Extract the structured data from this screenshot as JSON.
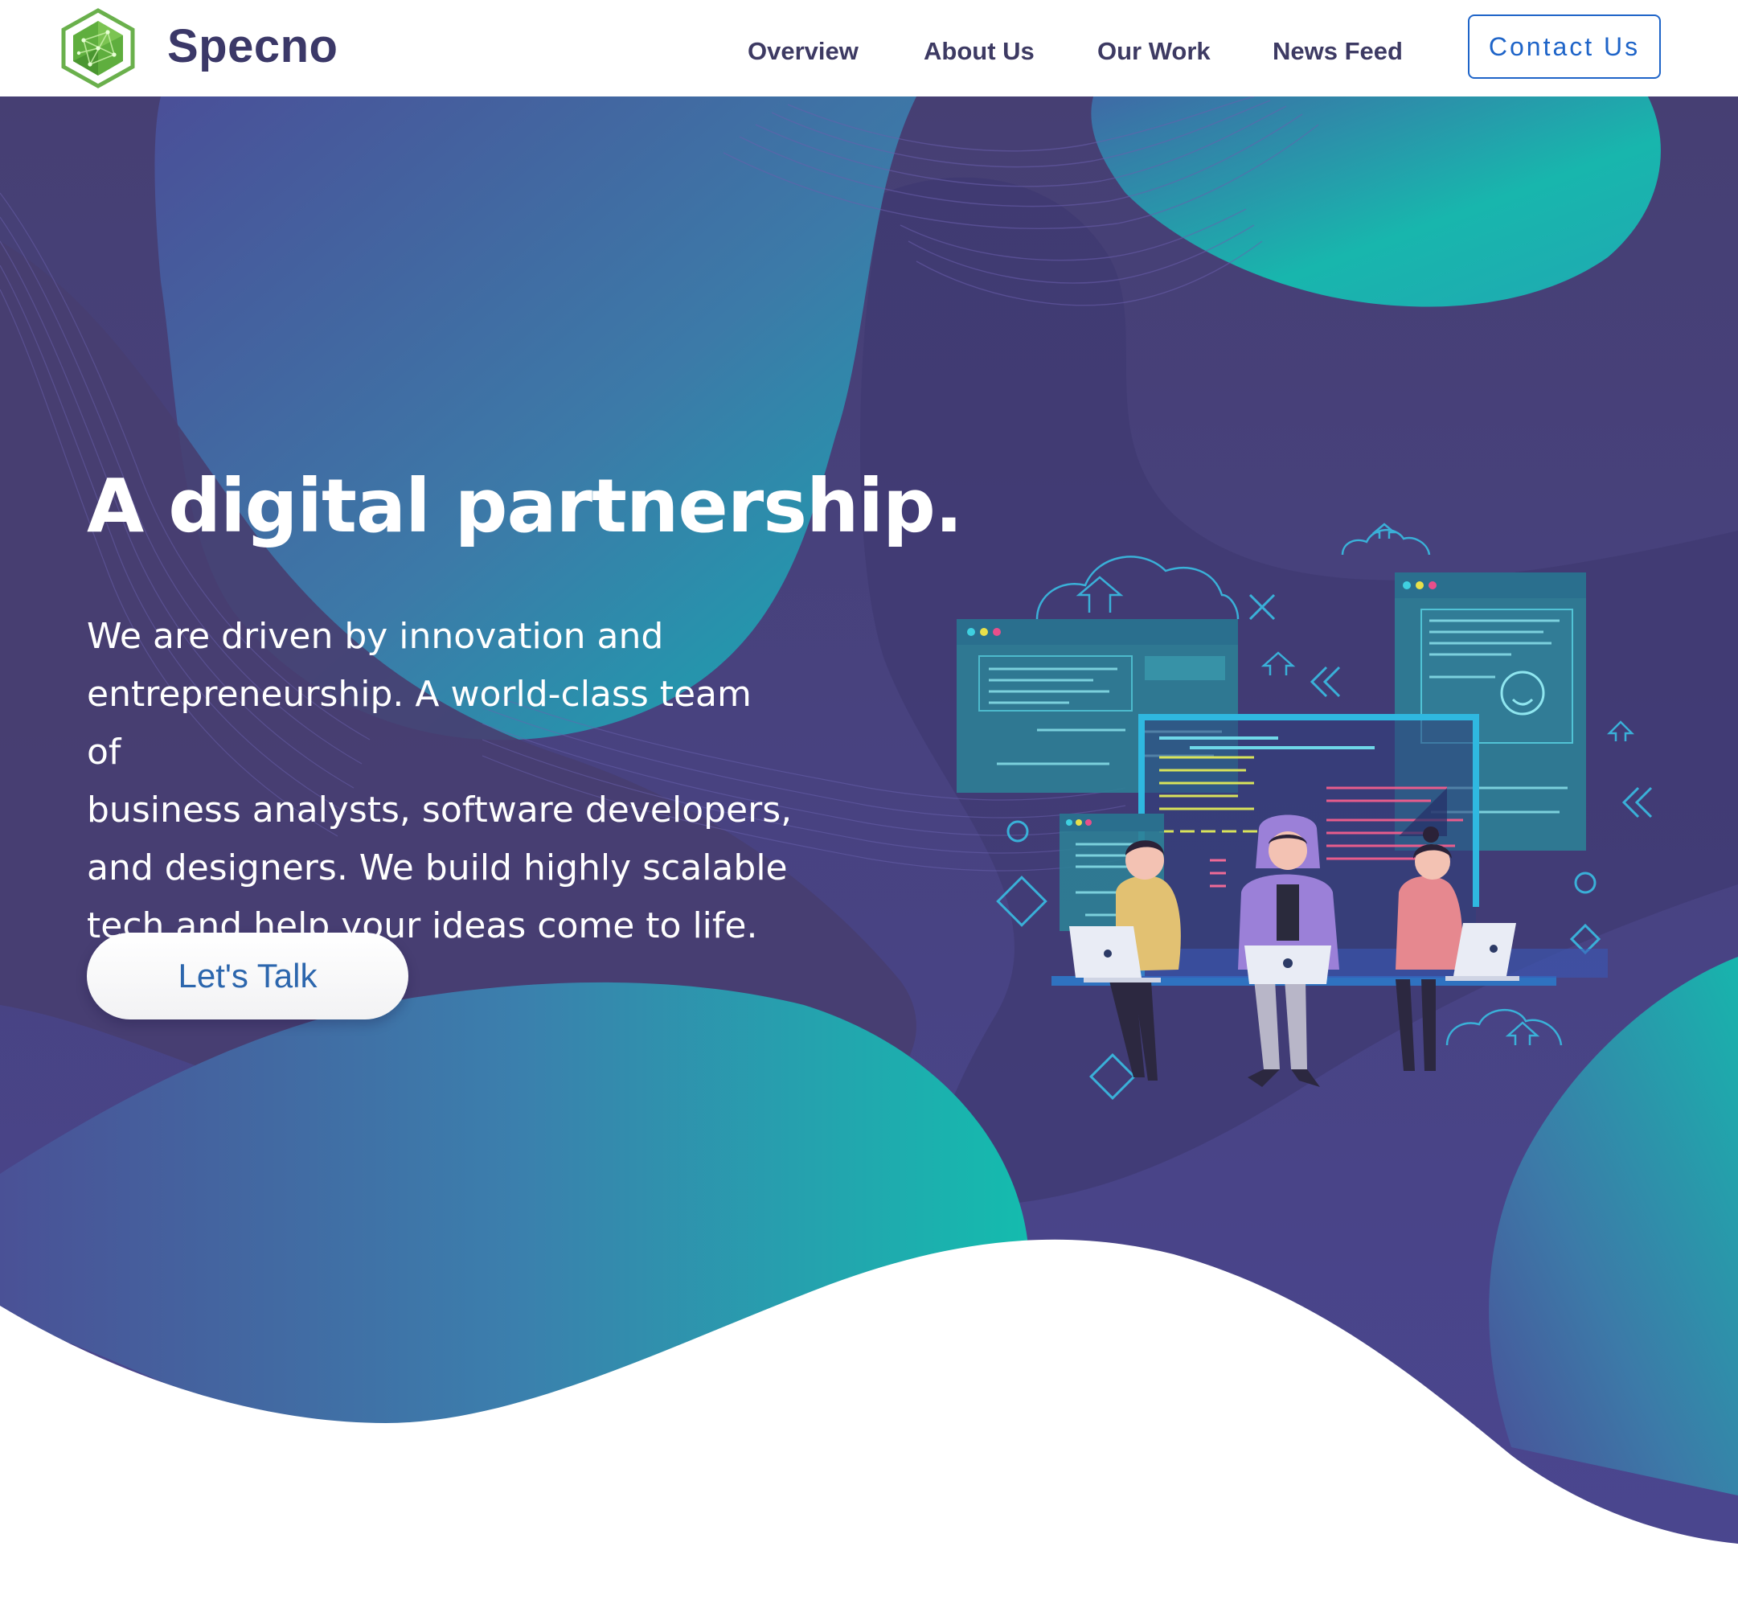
{
  "brand": {
    "name": "Specno",
    "logo_icon": "hexagon-network-icon",
    "logo_color": "#6ab04c"
  },
  "nav": {
    "items": [
      {
        "label": "Overview"
      },
      {
        "label": "About Us"
      },
      {
        "label": "Our Work"
      },
      {
        "label": "News Feed"
      }
    ],
    "contact_label": "Contact Us"
  },
  "hero": {
    "title": "A digital partnership.",
    "lines": [
      "We are driven by innovation and",
      "entrepreneurship. A world-class team of",
      "business analysts, software developers,",
      "and designers. We build highly scalable",
      "tech and help your ideas come to life."
    ],
    "cta_label": "Let's Talk"
  },
  "colors": {
    "accent": "#1e64c8",
    "hero_purple": "#46406e",
    "hero_teal": "#17b9ad",
    "text_dark": "#3d3a63"
  }
}
